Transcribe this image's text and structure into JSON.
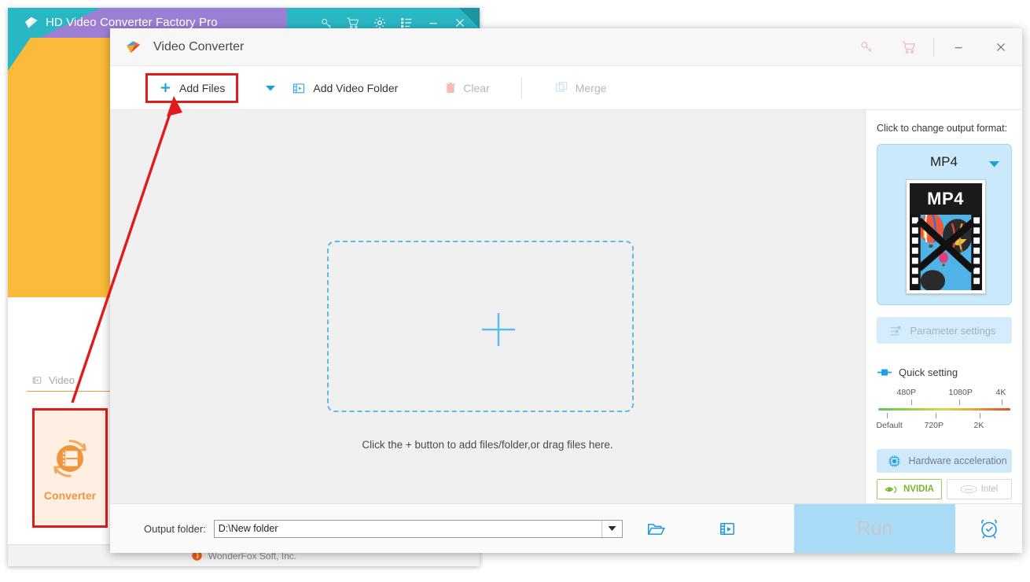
{
  "background_window": {
    "title": "HD Video Converter Factory Pro",
    "logo_icon": "play-diamond-icon",
    "titlebar_icons": [
      {
        "name": "key-icon",
        "label": "Register"
      },
      {
        "name": "cart-icon",
        "label": "Buy"
      },
      {
        "name": "gear-icon",
        "label": "Settings"
      },
      {
        "name": "list-icon",
        "label": "Task list"
      },
      {
        "name": "minimize-icon",
        "label": "Minimize"
      },
      {
        "name": "close-icon",
        "label": "Close"
      }
    ],
    "colors": {
      "teal": "#2ab7c4",
      "purple": "#9b7fd4",
      "orange": "#fcba3a"
    },
    "sidebar": {
      "video_tab": "Video",
      "video_tab_icon": "film-icon",
      "converter_tile": {
        "label": "Converter",
        "icon": "converter-film-circle-icon",
        "accent": "#f0953c",
        "highlight_color": "#e01b1b"
      }
    },
    "footer": {
      "company": "WonderFox Soft, Inc.",
      "icon": "wonderfox-flame-icon"
    }
  },
  "dialog": {
    "title": "Video Converter",
    "logo_icon": "pinwheel-play-icon",
    "titlebar_icons": [
      {
        "name": "key-icon",
        "label": "Register"
      },
      {
        "name": "cart-icon",
        "label": "Buy"
      },
      {
        "name": "minimize-icon",
        "label": "Minimize"
      },
      {
        "name": "close-icon",
        "label": "Close"
      }
    ],
    "toolbar": {
      "add_files": "Add Files",
      "add_files_icon": "plus-icon",
      "dropdown_icon": "chevron-down-icon",
      "add_video_folder": "Add Video Folder",
      "add_video_folder_icon": "folder-video-icon",
      "clear": "Clear",
      "clear_icon": "trash-icon",
      "merge": "Merge",
      "merge_icon": "merge-squares-icon"
    },
    "dropzone": {
      "plus_icon": "plus-large-icon",
      "hint": "Click the + button to add files/folder,or drag files here."
    },
    "right_panel": {
      "heading": "Click to change output format:",
      "format_name": "MP4",
      "format_caret_icon": "caret-down-icon",
      "thumbnail_label": "MP4",
      "parameter_settings": "Parameter settings",
      "parameter_settings_icon": "sliders-icon",
      "quick_setting": "Quick setting",
      "quick_setting_icon": "slider-handle-icon",
      "quality_scale": {
        "top_labels": [
          "480P",
          "1080P",
          "4K"
        ],
        "bottom_labels": [
          "Default",
          "720P",
          "2K"
        ]
      },
      "hardware_acceleration": "Hardware acceleration",
      "hardware_acceleration_icon": "cpu-chip-icon",
      "vendors": [
        {
          "label": "NVIDIA",
          "icon": "nvidia-eye-icon",
          "enabled": true
        },
        {
          "label": "Intel",
          "icon": "intel-icon",
          "enabled": false
        }
      ]
    },
    "bottom_bar": {
      "output_folder_label": "Output folder:",
      "output_folder_value": "D:\\New folder",
      "output_caret_icon": "caret-down-icon",
      "open_folder_icon": "folder-open-icon",
      "media_icon": "media-folder-icon",
      "run_label": "Run",
      "alarm_icon": "alarm-clock-icon"
    }
  },
  "annotation": {
    "arrow_color": "#e01b1b",
    "description": "arrow from Converter tile to Add Files button"
  }
}
